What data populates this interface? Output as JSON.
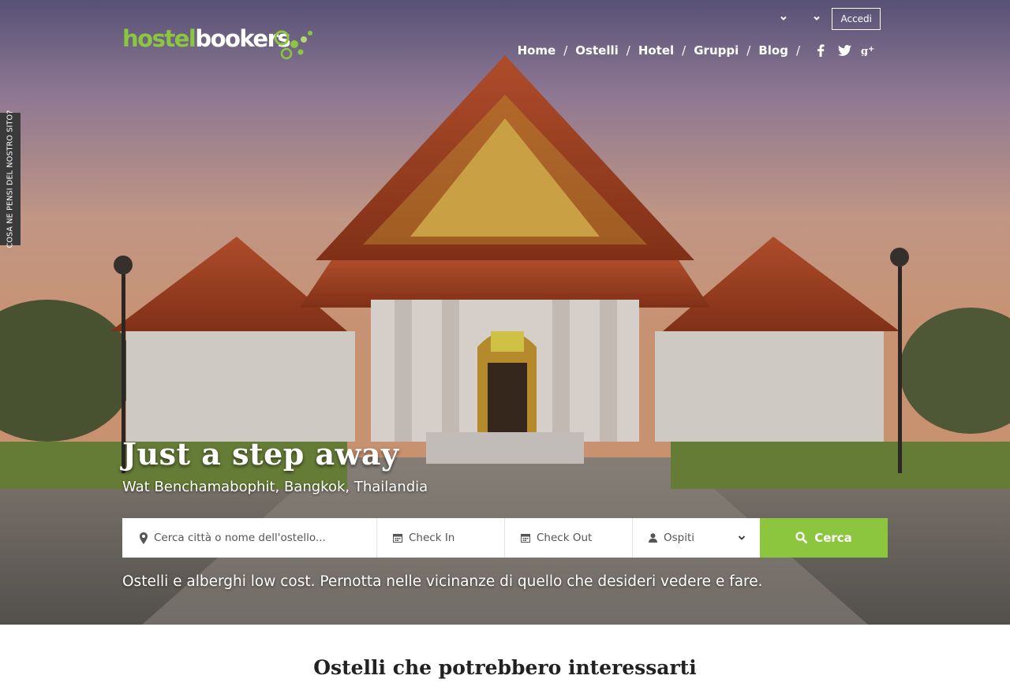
{
  "brand": {
    "logo_part1": "hostel",
    "logo_part2": "bookers",
    "accent": "#8cc63f"
  },
  "topbar": {
    "currency_select": "",
    "language_select": "",
    "login_label": "Accedi"
  },
  "nav": {
    "items": [
      {
        "label": "Home"
      },
      {
        "label": "Ostelli"
      },
      {
        "label": "Hotel"
      },
      {
        "label": "Gruppi"
      },
      {
        "label": "Blog"
      }
    ],
    "separator": "/",
    "social": [
      "facebook-icon",
      "twitter-icon",
      "google-plus-icon"
    ]
  },
  "feedback_tab": {
    "label": "COSA NE PENSI DEL NOSTRO SITO?"
  },
  "hero": {
    "title": "Just a step away",
    "subtitle": "Wat Benchamabophit, Bangkok, Thailandia",
    "tagline": "Ostelli e alberghi low cost. Pernotta nelle vicinanze di quello che desideri vedere e fare."
  },
  "search": {
    "destination_placeholder": "Cerca città o nome dell'ostello...",
    "checkin_placeholder": "Check In",
    "checkout_placeholder": "Check Out",
    "guests_label": "Ospiti",
    "button_label": "Cerca"
  },
  "section": {
    "title": "Ostelli che potrebbero interessarti"
  }
}
